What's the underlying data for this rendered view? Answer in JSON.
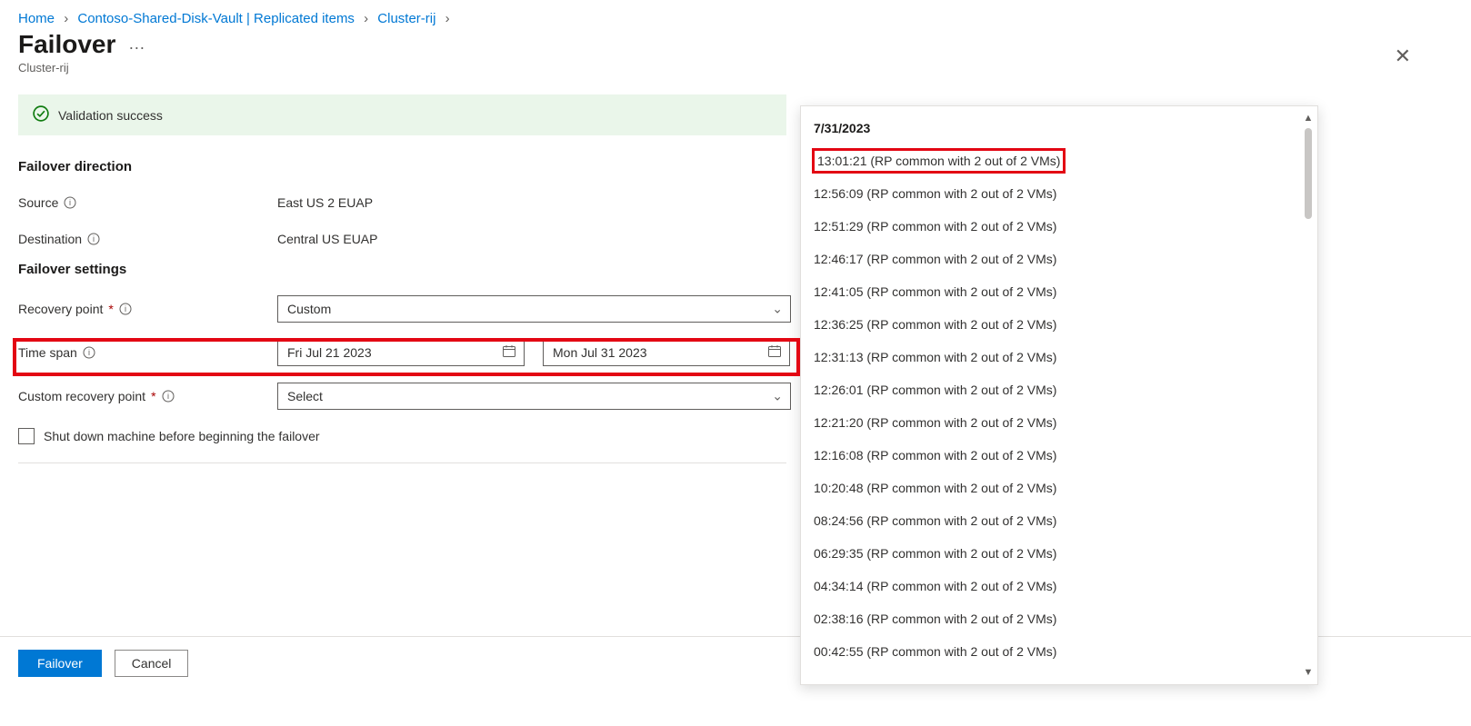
{
  "breadcrumb": {
    "home": "Home",
    "vault": "Contoso-Shared-Disk-Vault | Replicated items",
    "cluster": "Cluster-rij"
  },
  "title": "Failover",
  "resource_name": "Cluster-rij",
  "validation_message": "Validation success",
  "sections": {
    "direction_heading": "Failover direction",
    "settings_heading": "Failover settings"
  },
  "labels": {
    "source": "Source",
    "destination": "Destination",
    "recovery_point": "Recovery point",
    "time_span": "Time span",
    "custom_recovery_point": "Custom recovery point",
    "shutdown_checkbox": "Shut down machine before beginning the failover"
  },
  "values": {
    "source": "East US 2 EUAP",
    "destination": "Central US EUAP",
    "recovery_point_selected": "Custom",
    "time_span_from": "Fri Jul 21 2023",
    "time_span_to": "Mon Jul 31 2023",
    "custom_recovery_point_selected": "Select"
  },
  "footer": {
    "primary": "Failover",
    "secondary": "Cancel"
  },
  "flyout": {
    "date_header": "7/31/2023",
    "items": [
      "13:01:21 (RP common with 2 out of 2 VMs)",
      "12:56:09 (RP common with 2 out of 2 VMs)",
      "12:51:29 (RP common with 2 out of 2 VMs)",
      "12:46:17 (RP common with 2 out of 2 VMs)",
      "12:41:05 (RP common with 2 out of 2 VMs)",
      "12:36:25 (RP common with 2 out of 2 VMs)",
      "12:31:13 (RP common with 2 out of 2 VMs)",
      "12:26:01 (RP common with 2 out of 2 VMs)",
      "12:21:20 (RP common with 2 out of 2 VMs)",
      "12:16:08 (RP common with 2 out of 2 VMs)",
      "10:20:48 (RP common with 2 out of 2 VMs)",
      "08:24:56 (RP common with 2 out of 2 VMs)",
      "06:29:35 (RP common with 2 out of 2 VMs)",
      "04:34:14 (RP common with 2 out of 2 VMs)",
      "02:38:16 (RP common with 2 out of 2 VMs)",
      "00:42:55 (RP common with 2 out of 2 VMs)"
    ]
  }
}
